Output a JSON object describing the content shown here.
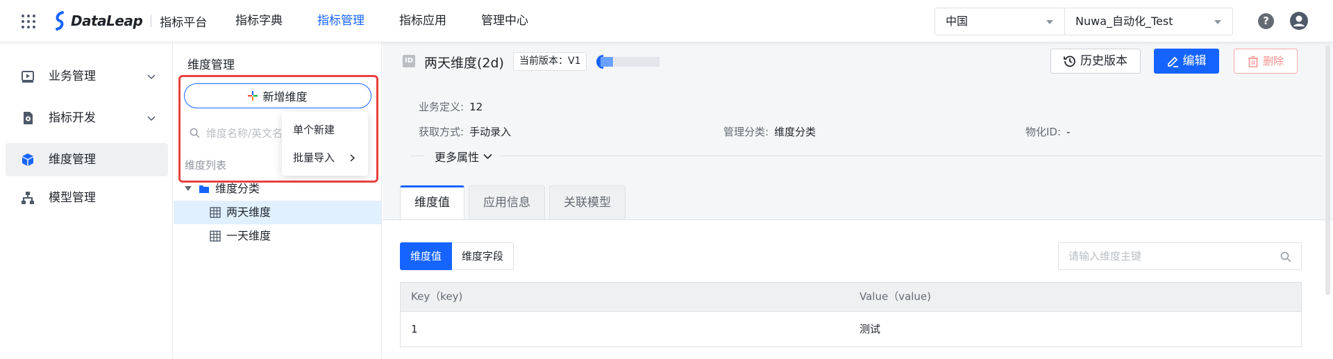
{
  "brand": {
    "name": "DataLeap",
    "platform": "指标平台"
  },
  "topnav": {
    "items": [
      {
        "label": "指标字典"
      },
      {
        "label": "指标管理"
      },
      {
        "label": "指标应用"
      },
      {
        "label": "管理中心"
      }
    ],
    "active_label": "指标管理"
  },
  "region_select": {
    "value": "中国"
  },
  "project_select": {
    "value": "Nuwa_自动化_Test"
  },
  "help": {
    "label": "?"
  },
  "sidebar": {
    "items": [
      {
        "label": "业务管理",
        "icon": "play-square-icon",
        "expandable": true
      },
      {
        "label": "指标开发",
        "icon": "gear-doc-icon",
        "expandable": true
      },
      {
        "label": "维度管理",
        "icon": "cube-icon",
        "expandable": false,
        "active": true
      },
      {
        "label": "模型管理",
        "icon": "hierarchy-icon",
        "expandable": false
      }
    ]
  },
  "tree_panel": {
    "title": "维度管理",
    "add_button": "新增维度",
    "search_placeholder": "维度名称/英文名",
    "list_label": "维度列表",
    "dropdown": {
      "items": [
        {
          "label": "单个新建"
        },
        {
          "label": "批量导入"
        }
      ]
    },
    "tree": {
      "folder": "维度分类",
      "children": [
        {
          "label": "两天维度",
          "selected": true
        },
        {
          "label": "一天维度",
          "selected": false
        }
      ]
    }
  },
  "detail": {
    "id_badge": "ID",
    "title": "两天维度(2d)",
    "version_tag": "当前版本：V1",
    "buttons": {
      "history": "历史版本",
      "edit": "编辑",
      "delete": "删除"
    },
    "props": {
      "business_def_label": "业务定义:",
      "business_def_value": "12",
      "acquire_label": "获取方式:",
      "acquire_value": "手动录入",
      "category_label": "管理分类:",
      "category_value": "维度分类",
      "materialize_label": "物化ID:",
      "materialize_value": "-"
    },
    "more_attributes": "更多属性",
    "tabs": [
      {
        "label": "维度值",
        "active": true
      },
      {
        "label": "应用信息"
      },
      {
        "label": "关联模型"
      }
    ],
    "segments": [
      {
        "label": "维度值",
        "active": true
      },
      {
        "label": "维度字段"
      }
    ],
    "key_search_placeholder": "请输入维度主键",
    "table": {
      "columns": [
        "Key（key)",
        "Value（value)"
      ],
      "rows": [
        {
          "key": "1",
          "value": "测试"
        }
      ]
    }
  },
  "colors": {
    "accent": "#1664ff",
    "danger": "#f5908d",
    "highlight": "#e8413f",
    "selected_row": "#e1f0ff"
  }
}
